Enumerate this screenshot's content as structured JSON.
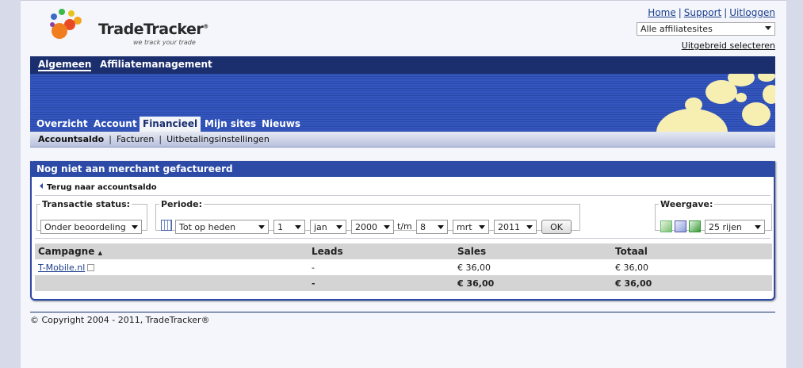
{
  "header": {
    "logo_text": "TradeTracker",
    "logo_reg": "®",
    "logo_tagline": "we track your trade",
    "links": [
      "Home",
      "Support",
      "Uitloggen"
    ],
    "site_select_value": "Alle affiliatesites",
    "advanced_select_label": "Uitgebreid selecteren"
  },
  "topnav": {
    "items": [
      "Algemeen",
      "Affiliatemanagement"
    ]
  },
  "subnav": {
    "items": [
      "Overzicht",
      "Account",
      "Financieel",
      "Mijn sites",
      "Nieuws"
    ]
  },
  "subsubnav": {
    "items": [
      "Accountsaldo",
      "Facturen",
      "Uitbetalingsinstellingen"
    ],
    "separator": "|"
  },
  "panel": {
    "title": "Nog niet aan merchant gefactureerd",
    "back_label": "Terug naar accountsaldo",
    "status": {
      "legend": "Transactie status:",
      "value": "Onder beoordeling"
    },
    "periode": {
      "legend": "Periode:",
      "range": "Tot op heden",
      "from_day": "1",
      "from_month": "jan",
      "from_year": "2000",
      "tm": "t/m",
      "to_day": "8",
      "to_month": "mrt",
      "to_year": "2011",
      "ok": "OK"
    },
    "weergave": {
      "legend": "Weergave:",
      "rows": "25 rijen"
    },
    "table": {
      "columns": [
        "Campagne",
        "Leads",
        "Sales",
        "Totaal"
      ],
      "sort_indicator": "▲",
      "rows": [
        {
          "campagne": "T-Mobile.nl",
          "leads": "-",
          "sales": "€ 36,00",
          "totaal": "€ 36,00"
        }
      ],
      "total": {
        "leads": "-",
        "sales": "€ 36,00",
        "totaal": "€ 36,00"
      }
    }
  },
  "footer": {
    "copyright": "© Copyright 2004 - 2011, TradeTracker®"
  }
}
